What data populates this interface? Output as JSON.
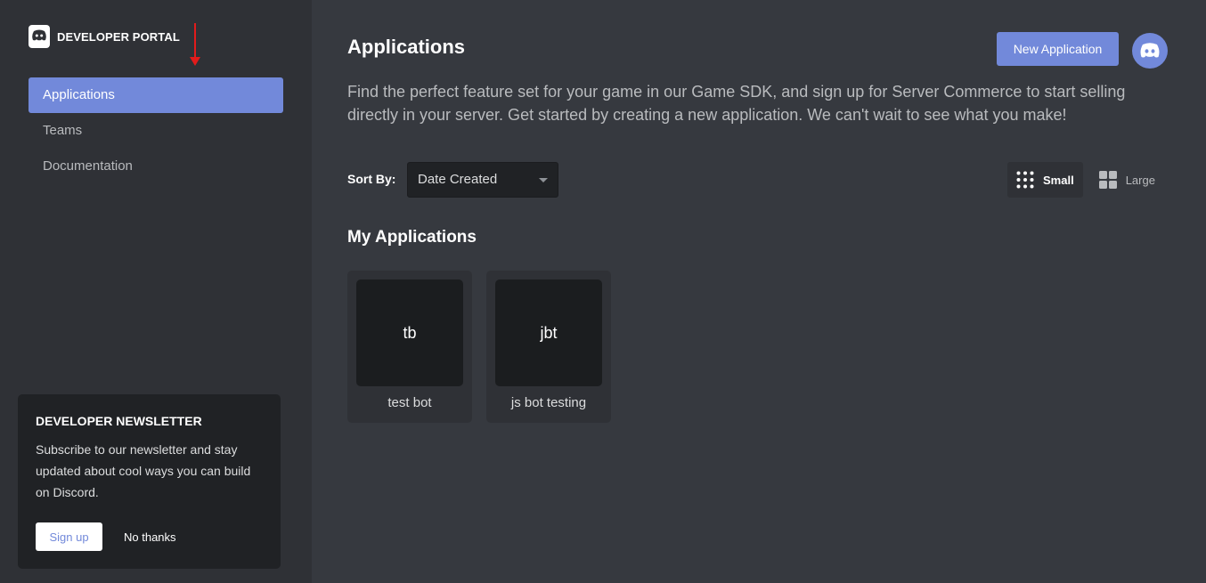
{
  "sidebar": {
    "brand_text": "DEVELOPER PORTAL",
    "nav": [
      {
        "label": "Applications",
        "active": true
      },
      {
        "label": "Teams",
        "active": false
      },
      {
        "label": "Documentation",
        "active": false
      }
    ]
  },
  "newsletter": {
    "title": "DEVELOPER NEWSLETTER",
    "text": "Subscribe to our newsletter and stay updated about cool ways you can build on Discord.",
    "signup_label": "Sign up",
    "decline_label": "No thanks"
  },
  "header": {
    "title": "Applications",
    "new_button_label": "New Application",
    "description": "Find the perfect feature set for your game in our Game SDK, and sign up for Server Commerce to start selling directly in your server. Get started by creating a new application. We can't wait to see what you make!"
  },
  "toolbar": {
    "sort_label": "Sort By:",
    "sort_value": "Date Created",
    "view_small_label": "Small",
    "view_large_label": "Large",
    "active_view": "Small"
  },
  "applications": {
    "title": "My Applications",
    "items": [
      {
        "initials": "tb",
        "name": "test bot"
      },
      {
        "initials": "jbt",
        "name": "js bot testing"
      }
    ]
  },
  "colors": {
    "accent": "#7289da",
    "background": "#36393f",
    "sidebar": "#2f3136",
    "annotation_arrow": "#e21b1b"
  },
  "icons": [
    "discord-logo-icon",
    "annotation-arrow-icon",
    "caret-down-icon",
    "grid-small-icon",
    "grid-large-icon",
    "discord-avatar-icon"
  ]
}
